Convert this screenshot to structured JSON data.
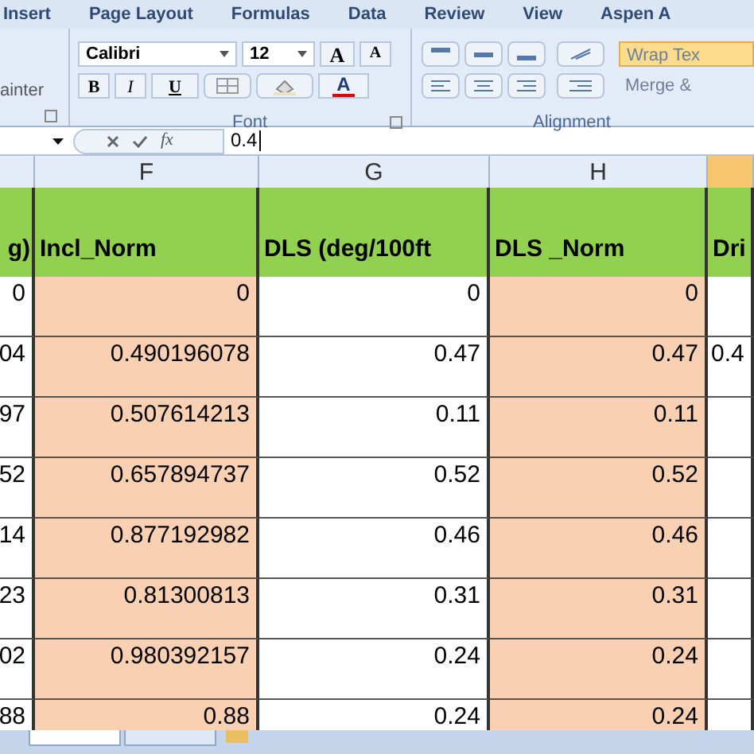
{
  "ribbon_tabs": [
    {
      "label": "Insert",
      "selected": false
    },
    {
      "label": "Page Layout",
      "selected": false
    },
    {
      "label": "Formulas",
      "selected": false
    },
    {
      "label": "Data",
      "selected": false
    },
    {
      "label": "Review",
      "selected": false
    },
    {
      "label": "View",
      "selected": false
    },
    {
      "label": "Aspen A",
      "selected": false
    }
  ],
  "clipboard_group": {
    "painter_label": "ainter"
  },
  "font_group": {
    "font_name": "Calibri",
    "font_size": "12",
    "bold_label": "B",
    "italic_label": "I",
    "underline_label": "U",
    "grow_label": "A",
    "shrink_label": "A",
    "color_label": "A",
    "label": "Font"
  },
  "alignment_group": {
    "wrap_text": "Wrap Tex",
    "merge": "Merge &",
    "label": "Alignment"
  },
  "formula_bar": {
    "fx": "fx",
    "value": "0.4"
  },
  "columns": [
    {
      "selected": false
    },
    {
      "letter": "F",
      "selected": false
    },
    {
      "letter": "G",
      "selected": false
    },
    {
      "letter": "H",
      "selected": false
    },
    {
      "selected": true
    }
  ],
  "header_row": [
    "g)",
    "Incl_Norm",
    "DLS (deg/100ft",
    "DLS _Norm",
    "Dri"
  ],
  "rows": [
    [
      "0",
      "0",
      "0",
      "0",
      ""
    ],
    [
      "04",
      "0.490196078",
      "0.47",
      "0.47",
      "0.4"
    ],
    [
      "97",
      "0.507614213",
      "0.11",
      "0.11",
      ""
    ],
    [
      "52",
      "0.657894737",
      "0.52",
      "0.52",
      ""
    ],
    [
      "14",
      "0.877192982",
      "0.46",
      "0.46",
      ""
    ],
    [
      "23",
      "0.81300813",
      "0.31",
      "0.31",
      ""
    ],
    [
      "02",
      "0.980392157",
      "0.24",
      "0.24",
      ""
    ],
    [
      "88",
      "0.88",
      "0.24",
      "0.24",
      ""
    ]
  ]
}
